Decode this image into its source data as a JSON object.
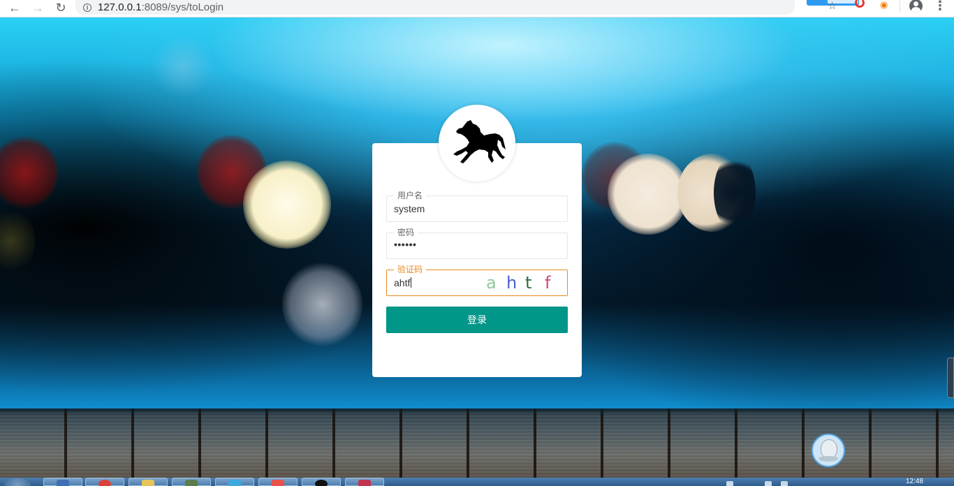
{
  "browser": {
    "url_host": "127.0.0.1",
    "url_rest": ":8089/sys/toLogin"
  },
  "login": {
    "username": {
      "label": "用户名",
      "value": "system"
    },
    "password": {
      "label": "密码",
      "value": "••••••"
    },
    "captcha": {
      "label": "验证码",
      "value": "ahtf",
      "image_chars": [
        {
          "char": "a",
          "color": "#8fc99a"
        },
        {
          "char": "h",
          "color": "#4a5fd0"
        },
        {
          "char": "t",
          "color": "#2e6b3c"
        },
        {
          "char": "f",
          "color": "#d0496a"
        }
      ]
    },
    "submit_label": "登录",
    "accent_color": "#009688",
    "focus_color": "#e8891f"
  },
  "taskbar": {
    "clock": "12:48"
  }
}
